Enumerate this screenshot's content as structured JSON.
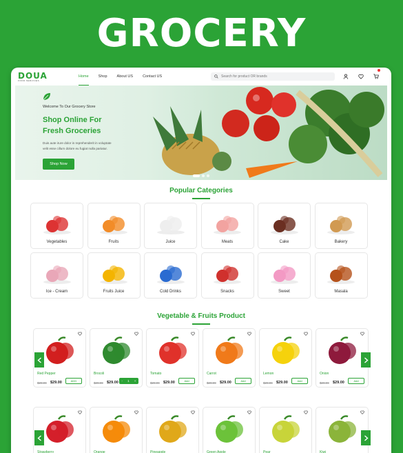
{
  "hero_title": "GROCERY",
  "logo": {
    "name": "DOUA",
    "tagline": "FOOD SERVICES"
  },
  "nav": {
    "items": [
      "Home",
      "Shop",
      "About US",
      "Contact US"
    ]
  },
  "search": {
    "placeholder": "Search for product OR brands"
  },
  "banner": {
    "welcome": "Welcome To Our Grocery Store",
    "headline_1": "Shop Online For",
    "headline_2": "Fresh Groceries",
    "desc_1": "Duis aute irure dolor in reprehenderit in voluptate",
    "desc_2": "velit esse cillum dolore eu fugiat nulla pariatur.",
    "button": "Shop Now"
  },
  "categories_title": "Popular Categories",
  "categories": [
    {
      "label": "Vegetables",
      "icon": "vegetables-icon",
      "color": "#d33"
    },
    {
      "label": "Fruits",
      "icon": "fruits-icon",
      "color": "#f28c28"
    },
    {
      "label": "Juice",
      "icon": "juice-icon",
      "color": "#eeeeee"
    },
    {
      "label": "Meats",
      "icon": "meat-icon",
      "color": "#f2a3a0"
    },
    {
      "label": "Cake",
      "icon": "cake-icon",
      "color": "#6b2f22"
    },
    {
      "label": "Bakery",
      "icon": "bakery-icon",
      "color": "#d19a52"
    },
    {
      "label": "Ice - Cream",
      "icon": "ice-cream-icon",
      "color": "#e9a7b8"
    },
    {
      "label": "Fruits Juice",
      "icon": "fruit-juice-icon",
      "color": "#f4b400"
    },
    {
      "label": "Cold Drinks",
      "icon": "cold-drinks-icon",
      "color": "#2a6bd1"
    },
    {
      "label": "Snacks",
      "icon": "snacks-icon",
      "color": "#d0312d"
    },
    {
      "label": "Sweet",
      "icon": "sweet-icon",
      "color": "#f39ac4"
    },
    {
      "label": "Masala",
      "icon": "masala-icon",
      "color": "#b5521b"
    }
  ],
  "products_title": "Vegetable & Fruits Product",
  "products": [
    {
      "name": "Red Pepper",
      "old": "$29.99",
      "price": "$29.00",
      "action": "ADD",
      "color": "#d21f1f"
    },
    {
      "name": "Brocoli",
      "old": "$29.99",
      "price": "$29.00",
      "action": "stepper",
      "color": "#2f8a2f",
      "stepper": [
        "-",
        "1",
        "+"
      ]
    },
    {
      "name": "Tomato",
      "old": "$29.99",
      "price": "$29.00",
      "action": "Add",
      "color": "#e0322b"
    },
    {
      "name": "Carrot",
      "old": "$29.99",
      "price": "$29.00",
      "action": "Add",
      "color": "#f07a1a"
    },
    {
      "name": "Lemon",
      "old": "$29.99",
      "price": "$29.00",
      "action": "Add",
      "color": "#f5d20c"
    },
    {
      "name": "Onion",
      "old": "$29.99",
      "price": "$29.00",
      "action": "Add",
      "color": "#8e1a3c"
    }
  ],
  "products_row2": [
    {
      "name": "Strawberry",
      "color": "#d41f2a"
    },
    {
      "name": "Orange",
      "color": "#f58b0a"
    },
    {
      "name": "Pineapple",
      "color": "#e0a81a"
    },
    {
      "name": "Green Apple",
      "color": "#6cc23a"
    },
    {
      "name": "Pear",
      "color": "#c8d43a"
    },
    {
      "name": "Kiwi",
      "color": "#8bb43a"
    }
  ],
  "accent": "#2ba336"
}
